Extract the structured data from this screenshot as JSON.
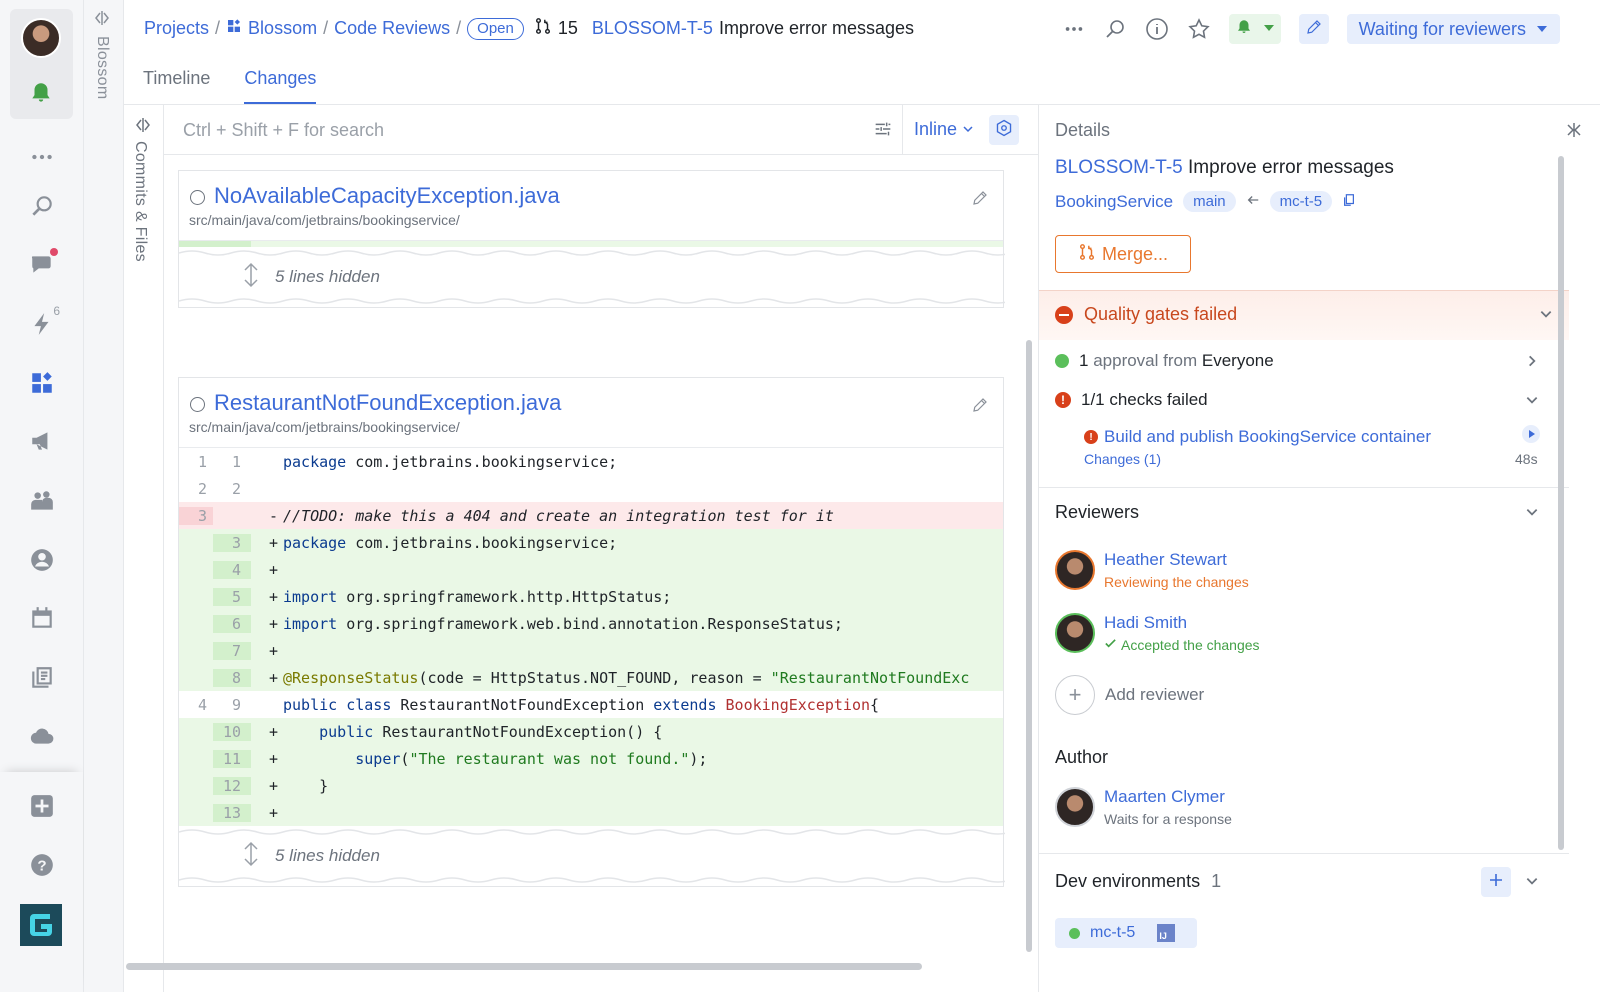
{
  "breadcrumb": {
    "projects": "Projects",
    "sep": "/",
    "project": "Blossom",
    "section": "Code Reviews",
    "state": "Open",
    "review_number": "15",
    "review_key": "BLOSSOM-T-5",
    "review_title": "Improve error messages"
  },
  "header": {
    "status_label": "Waiting for reviewers"
  },
  "project_strip": {
    "label": "Blossom"
  },
  "tabs": [
    {
      "label": "Timeline",
      "active": false
    },
    {
      "label": "Changes",
      "active": true
    }
  ],
  "commits_strip": {
    "label": "Commits & Files"
  },
  "diff_toolbar": {
    "search_placeholder": "Ctrl + Shift + F for search",
    "view_mode": "Inline"
  },
  "files": [
    {
      "name": "NoAvailableCapacityException.java",
      "path": "src/main/java/com/jetbrains/bookingservice/",
      "hidden_lines": "5 lines hidden"
    },
    {
      "name": "RestaurantNotFoundException.java",
      "path": "src/main/java/com/jetbrains/bookingservice/",
      "hidden_lines": "5 lines hidden",
      "lines": [
        {
          "old": "1",
          "new": "1",
          "type": "ctx",
          "mark": "",
          "code": "package com.jetbrains.bookingservice;"
        },
        {
          "old": "2",
          "new": "2",
          "type": "ctx",
          "mark": "",
          "code": ""
        },
        {
          "old": "3",
          "new": "",
          "type": "del",
          "mark": "-",
          "code": "//TODO: make this a 404 and create an integration test for it"
        },
        {
          "old": "",
          "new": "3",
          "type": "add",
          "mark": "+",
          "code": "package com.jetbrains.bookingservice;"
        },
        {
          "old": "",
          "new": "4",
          "type": "add",
          "mark": "+",
          "code": ""
        },
        {
          "old": "",
          "new": "5",
          "type": "add",
          "mark": "+",
          "code": "import org.springframework.http.HttpStatus;"
        },
        {
          "old": "",
          "new": "6",
          "type": "add",
          "mark": "+",
          "code": "import org.springframework.web.bind.annotation.ResponseStatus;"
        },
        {
          "old": "",
          "new": "7",
          "type": "add",
          "mark": "+",
          "code": ""
        },
        {
          "old": "",
          "new": "8",
          "type": "add",
          "mark": "+",
          "code": "@ResponseStatus(code = HttpStatus.NOT_FOUND, reason = \"RestaurantNotFoundExc"
        },
        {
          "old": "4",
          "new": "9",
          "type": "ctx",
          "mark": "",
          "code": "public class RestaurantNotFoundException extends BookingException{"
        },
        {
          "old": "",
          "new": "10",
          "type": "add",
          "mark": "+",
          "code": "    public RestaurantNotFoundException() {"
        },
        {
          "old": "",
          "new": "11",
          "type": "add",
          "mark": "+",
          "code": "        super(\"The restaurant was not found.\");"
        },
        {
          "old": "",
          "new": "12",
          "type": "add",
          "mark": "+",
          "code": "    }"
        },
        {
          "old": "",
          "new": "13",
          "type": "add",
          "mark": "+",
          "code": ""
        }
      ]
    }
  ],
  "details": {
    "title": "Details",
    "review_key": "BLOSSOM-T-5",
    "review_title": "Improve error messages",
    "repository": "BookingService",
    "target_branch": "main",
    "source_branch": "mc-t-5",
    "merge_label": "Merge...",
    "quality_gates": "Quality gates failed",
    "approval_count": "1",
    "approval_text": "approval from",
    "approval_from": "Everyone",
    "checks_text": "1/1 checks failed",
    "check_name": "Build and publish BookingService container",
    "check_changes": "Changes (1)",
    "check_duration": "48s",
    "reviewers_title": "Reviewers",
    "reviewers": [
      {
        "name": "Heather Stewart",
        "status": "Reviewing the changes",
        "status_color": "#e8772e"
      },
      {
        "name": "Hadi Smith",
        "status": "Accepted the changes",
        "status_color": "#43a047"
      }
    ],
    "add_reviewer": "Add reviewer",
    "author_title": "Author",
    "author": {
      "name": "Maarten Clymer",
      "status": "Waits for a response"
    },
    "dev_env_title": "Dev environments",
    "dev_env_count": "1",
    "dev_env_name": "mc-t-5",
    "dev_env_ide": "IJ"
  },
  "colors": {
    "accent": "#3d6bd8",
    "added": "#eaf8e6",
    "removed": "#fde9ea",
    "warning": "#e8772e",
    "error": "#d8401a",
    "success": "#5bbf5b"
  }
}
